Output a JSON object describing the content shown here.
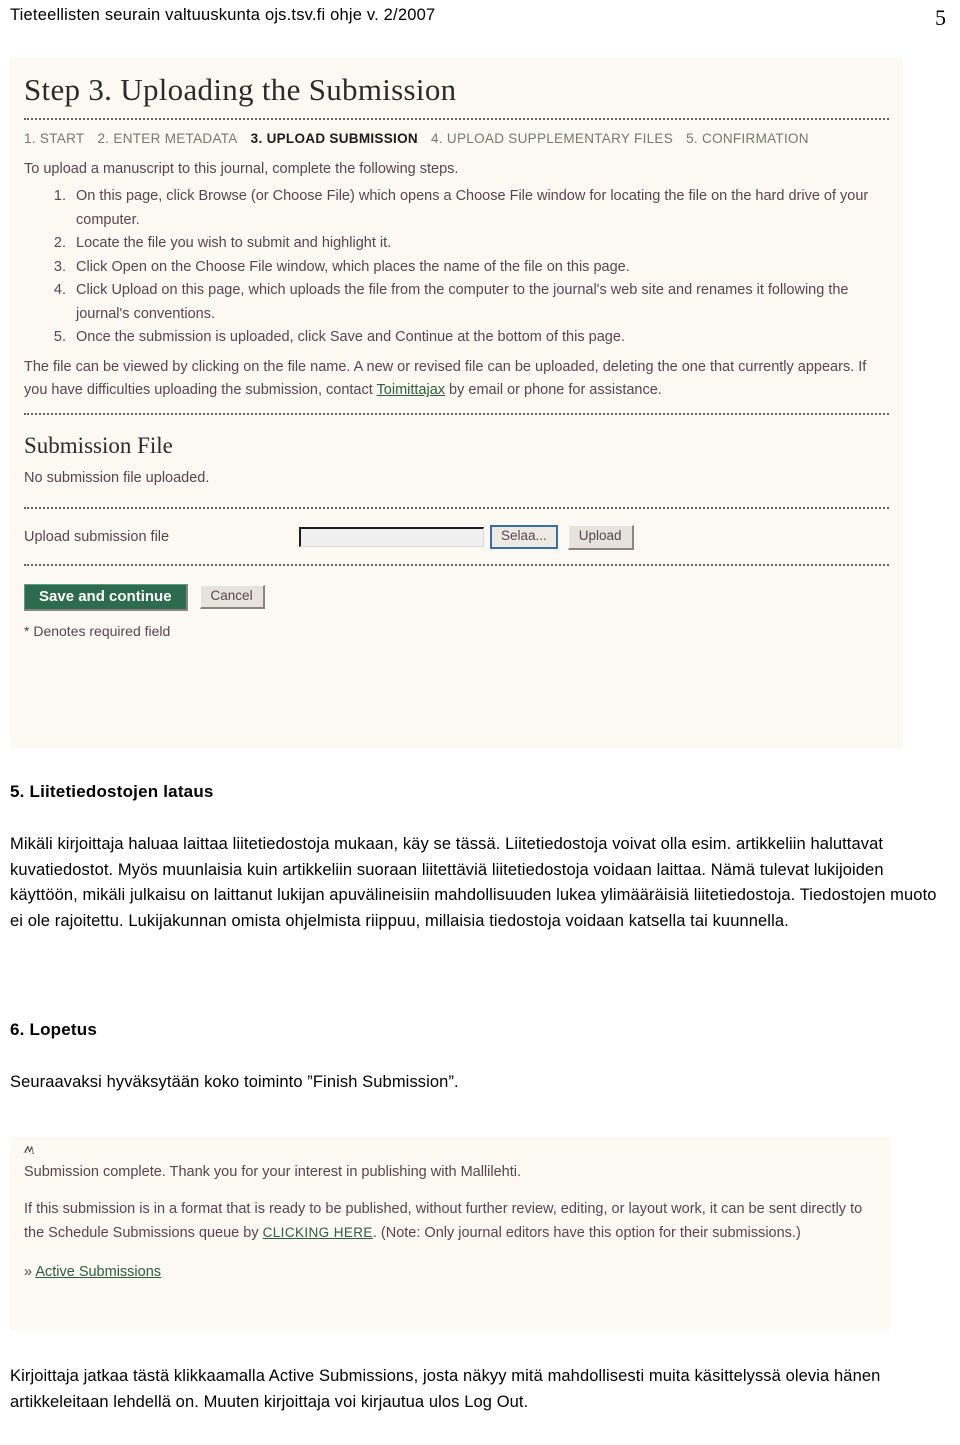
{
  "header": {
    "running_title": "Tieteellisten seurain valtuuskunta ojs.tsv.fi ohje v. 2/2007",
    "page_number": "5"
  },
  "colors": {
    "screenshot_background": "#fbf9f1",
    "ojs_body_text": "#5b4452",
    "ojs_link_green": "#2f5d3f",
    "breadcrumb_inactive": "#6f7d6a",
    "save_button_green": "#2d6b4f",
    "focus_border_blue": "#3b6ea8"
  },
  "screenshot_upload": {
    "heading": "Step 3. Uploading the Submission",
    "breadcrumb": [
      {
        "label": "1. START",
        "current": false
      },
      {
        "label": "2. ENTER METADATA",
        "current": false
      },
      {
        "label": "3. UPLOAD SUBMISSION",
        "current": true
      },
      {
        "label": "4. UPLOAD SUPPLEMENTARY FILES",
        "current": false
      },
      {
        "label": "5. CONFIRMATION",
        "current": false
      }
    ],
    "intro": "To upload a manuscript to this journal, complete the following steps.",
    "steps": [
      "On this page, click Browse (or Choose File) which opens a Choose File window for locating the file on the hard drive of your computer.",
      "Locate the file you wish to submit and highlight it.",
      "Click Open on the Choose File window, which places the name of the file on this page.",
      "Click Upload on this page, which uploads the file from the computer to the journal's web site and renames it following the journal's conventions.",
      "Once the submission is uploaded, click Save and Continue at the bottom of this page."
    ],
    "note_part1": "The file can be viewed by clicking on the file name. A new or revised file can be uploaded, deleting the one that currently appears. If you have difficulties uploading the submission, contact ",
    "note_link": "Toimittajax",
    "note_part2": " by email or phone for assistance.",
    "section_heading": "Submission File",
    "no_file_text": "No submission file uploaded.",
    "upload_label": "Upload submission file",
    "file_field_value": "",
    "browse_button": "Selaa...",
    "upload_button": "Upload",
    "save_button": "Save and continue",
    "cancel_button": "Cancel",
    "required_note": "* Denotes required field"
  },
  "section_5": {
    "heading": "5. Liitetiedostojen lataus",
    "paragraph_lines": [
      "Mikäli kirjoittaja haluaa laittaa liitetiedostoja mukaan, käy se tässä. Liitetiedostoja",
      "voivat olla esim. artikkeliin haluttavat kuvatiedostot. Myös muunlaisia kuin artikkeliin",
      "suoraan liitettäviä liitetiedostoja voidaan laittaa. Nämä tulevat lukijoiden käyttöön,",
      "mikäli julkaisu on laittanut lukijan apuvälineisiin mahdollisuuden lukea ylimääräisiä",
      "liitetiedostoja. Tiedostojen muoto ei ole rajoitettu. Lukijakunnan omista ohjelmista",
      "riippuu, millaisia tiedostoja voidaan katsella tai kuunnella."
    ]
  },
  "section_6": {
    "heading": "6. Lopetus",
    "paragraph": "Seuraavaksi hyväksytään koko toiminto ”Finish Submission”."
  },
  "screenshot_complete": {
    "cursor_glyph": "ʍ",
    "line1": "Submission complete. Thank you for your interest in publishing with Mallilehti.",
    "para_part1": "If this submission is in a format that is ready to be published, without further review, editing, or layout work, it can be sent directly to the Schedule Submissions queue by ",
    "para_link": "CLICKING HERE",
    "para_part2": ". (Note: Only journal editors have this option for their submissions.)",
    "bullet_marker": "»",
    "active_submissions_link": "Active Submissions"
  },
  "closing": {
    "lines": [
      "Kirjoittaja jatkaa tästä klikkaamalla Active Submissions, josta näkyy mitä",
      "mahdollisesti muita käsittelyssä olevia hänen artikkeleitaan lehdellä on. Muuten",
      "kirjoittaja voi kirjautua ulos Log Out."
    ]
  }
}
